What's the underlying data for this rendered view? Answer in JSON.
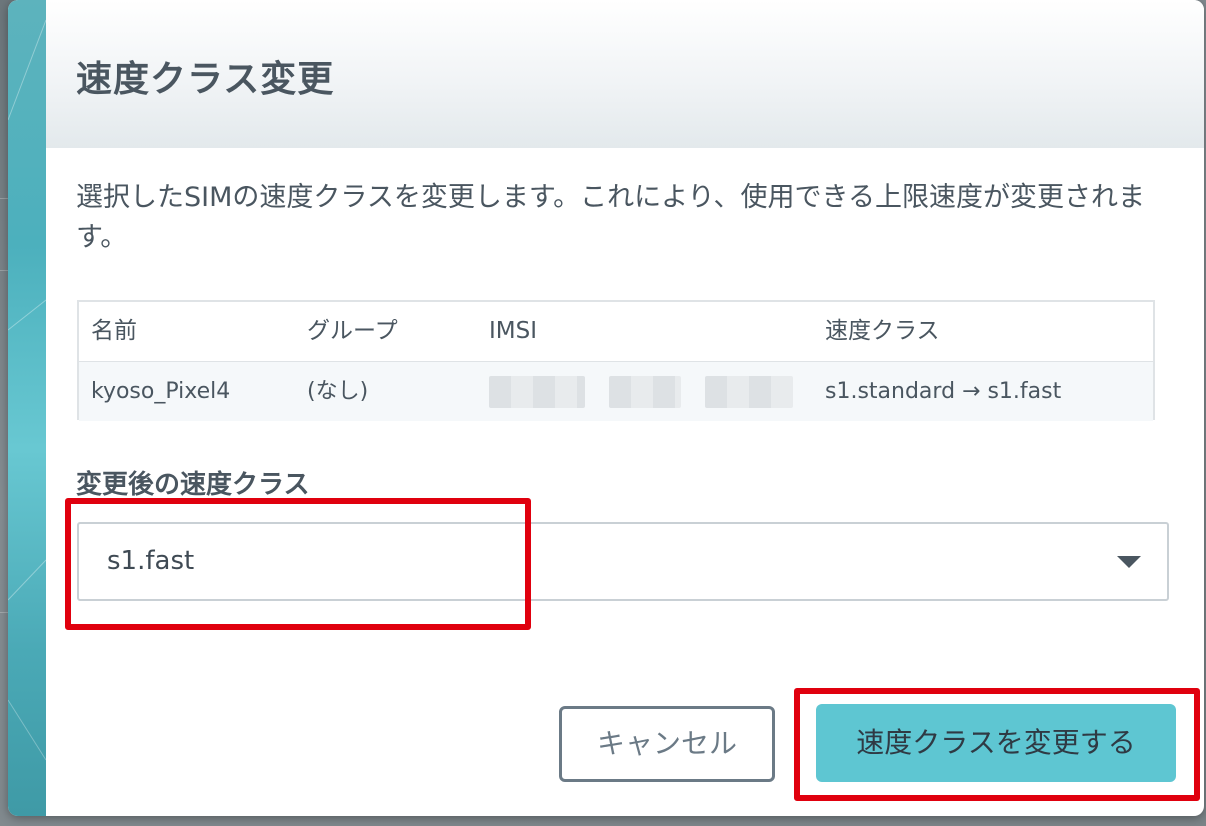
{
  "dialog": {
    "title": "速度クラス変更",
    "description": "選択したSIMの速度クラスを変更します。これにより、使用できる上限速度が変更されます。"
  },
  "table": {
    "headers": [
      "名前",
      "グループ",
      "IMSI",
      "速度クラス"
    ],
    "rows": [
      {
        "name": "kyoso_Pixel4",
        "group": "(なし)",
        "imsi": "",
        "speed_class": "s1.standard → s1.fast"
      }
    ]
  },
  "speed_class_field": {
    "label": "変更後の速度クラス",
    "selected_value": "s1.fast"
  },
  "buttons": {
    "cancel": "キャンセル",
    "submit": "速度クラスを変更する"
  },
  "colors": {
    "accent": "#5ec6d2",
    "highlight": "#e0000e",
    "text": "#4a5660"
  }
}
